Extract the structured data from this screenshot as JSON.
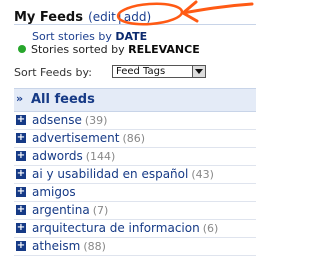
{
  "header": {
    "title": "My Feeds",
    "edit_label": "edit",
    "add_label": "add"
  },
  "sort": {
    "date_prefix": "Sort stories by ",
    "date_value": "DATE",
    "relevance_prefix": "Stories sorted by ",
    "relevance_value": "RELEVANCE"
  },
  "filter": {
    "label": "Sort Feeds by:",
    "selected": "Feed Tags"
  },
  "feeds": {
    "all_label": "All feeds",
    "items": [
      {
        "name": "adsense",
        "count": "(39)"
      },
      {
        "name": "advertisement",
        "count": "(86)"
      },
      {
        "name": "adwords",
        "count": "(144)"
      },
      {
        "name": "ai y usabilidad en español",
        "count": "(43)"
      },
      {
        "name": "amigos",
        "count": ""
      },
      {
        "name": "argentina",
        "count": "(7)"
      },
      {
        "name": "arquitectura de informacion",
        "count": "(6)"
      },
      {
        "name": "atheism",
        "count": "(88)"
      }
    ]
  },
  "colors": {
    "link": "#1c3f8f",
    "status_green": "#27a62c",
    "annotation": "#ff5a14"
  }
}
